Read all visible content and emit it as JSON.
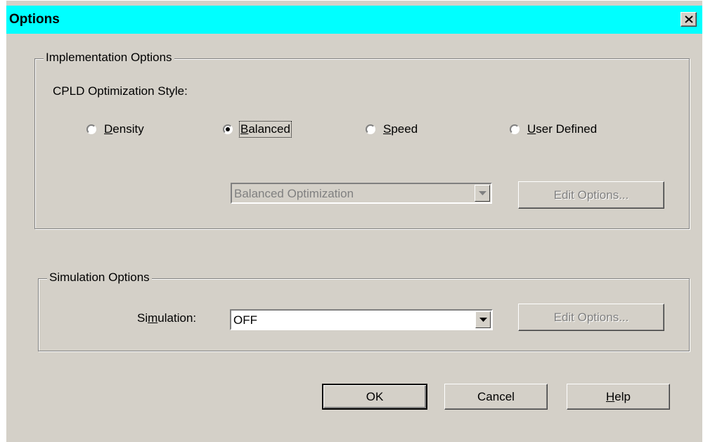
{
  "window": {
    "title": "Options"
  },
  "implementation": {
    "legend": "Implementation Options",
    "style_label": "CPLD Optimization Style:",
    "radios": [
      {
        "label": "Density",
        "selected": false
      },
      {
        "label": "Balanced",
        "selected": true
      },
      {
        "label": "Speed",
        "selected": false
      },
      {
        "label": "User Defined",
        "selected": false
      }
    ],
    "optimization_combo": {
      "value": "Balanced Optimization",
      "enabled": false
    },
    "edit_options_label": "Edit Options..."
  },
  "simulation": {
    "legend": "Simulation Options",
    "label": "Simulation:",
    "combo": {
      "value": "OFF",
      "enabled": true
    },
    "edit_options_label": "Edit Options..."
  },
  "buttons": {
    "ok": "OK",
    "cancel": "Cancel",
    "help": "Help"
  },
  "colors": {
    "title_bar": "#00ffff",
    "face": "#d4d0c8",
    "disabled_text": "#808080"
  },
  "icons": {
    "close": "close-icon",
    "dropdown": "chevron-down-icon"
  }
}
